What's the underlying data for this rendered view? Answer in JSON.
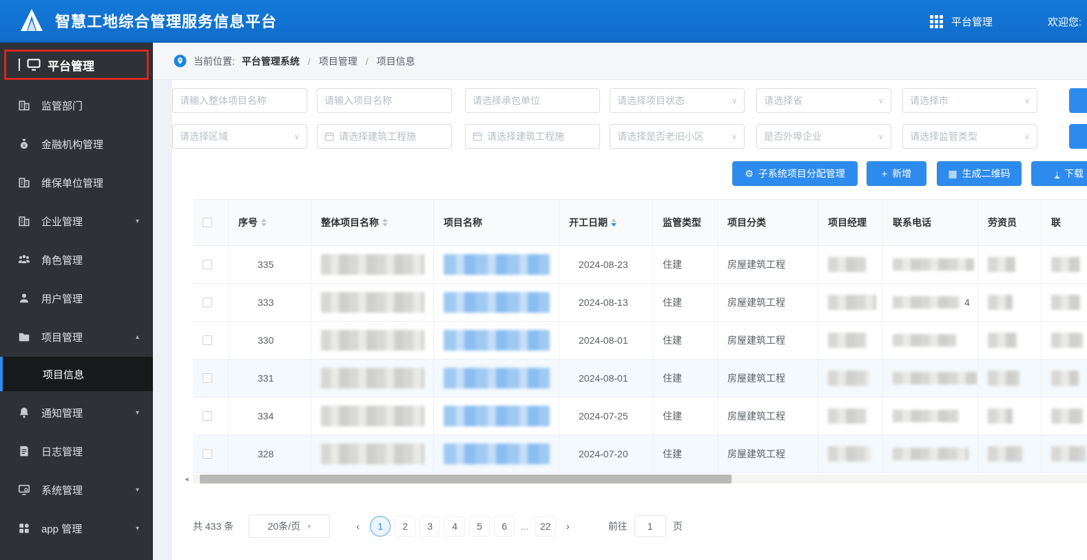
{
  "header": {
    "title": "智慧工地综合管理服务信息平台",
    "apps_label": "平台管理",
    "welcome": "欢迎您:"
  },
  "sidebar": {
    "root_label": "平台管理",
    "items": [
      {
        "label": "监管部门",
        "icon": "building-icon",
        "arrow": ""
      },
      {
        "label": "金融机构管理",
        "icon": "moneybag-icon",
        "arrow": ""
      },
      {
        "label": "维保单位管理",
        "icon": "building-icon",
        "arrow": ""
      },
      {
        "label": "企业管理",
        "icon": "building-icon",
        "arrow": "down"
      },
      {
        "label": "角色管理",
        "icon": "roles-icon",
        "arrow": ""
      },
      {
        "label": "用户管理",
        "icon": "user-icon",
        "arrow": ""
      },
      {
        "label": "项目管理",
        "icon": "folder-icon",
        "arrow": "up",
        "children": [
          {
            "label": "项目信息",
            "active": true
          }
        ]
      },
      {
        "label": "通知管理",
        "icon": "bell-icon",
        "arrow": "down"
      },
      {
        "label": "日志管理",
        "icon": "log-icon",
        "arrow": ""
      },
      {
        "label": "系统管理",
        "icon": "monitor-icon",
        "arrow": "down"
      },
      {
        "label": "app 管理",
        "icon": "grid-icon",
        "arrow": "down"
      }
    ]
  },
  "breadcrumb": {
    "prefix": "当前位置:",
    "root": "平台管理系统",
    "items": [
      "项目管理",
      "项目信息"
    ]
  },
  "filters": {
    "row1": [
      {
        "type": "input",
        "placeholder": "请输入整体项目名称"
      },
      {
        "type": "input",
        "placeholder": "请输入项目名称"
      },
      {
        "type": "input",
        "placeholder": "请选择承包单位"
      },
      {
        "type": "select",
        "placeholder": "请选择项目状态"
      },
      {
        "type": "select",
        "placeholder": "请选择省"
      },
      {
        "type": "select",
        "placeholder": "请选择市"
      }
    ],
    "row2": [
      {
        "type": "select",
        "placeholder": "请选择区域"
      },
      {
        "type": "date",
        "placeholder": "请选择建筑工程施"
      },
      {
        "type": "date",
        "placeholder": "请选择建筑工程施"
      },
      {
        "type": "select",
        "placeholder": "请选择是否老旧小区"
      },
      {
        "type": "select",
        "placeholder": "是否外埠企业"
      },
      {
        "type": "select",
        "placeholder": "请选择监管类型"
      }
    ]
  },
  "actions": [
    {
      "label": "子系统项目分配管理",
      "icon": "gear-icon"
    },
    {
      "label": "新增",
      "icon": "plus-icon"
    },
    {
      "label": "生成二维码",
      "icon": "qrcode-icon"
    },
    {
      "label": "下载",
      "icon": "download-icon"
    }
  ],
  "table": {
    "columns": [
      {
        "label": "",
        "type": "checkbox"
      },
      {
        "label": "序号",
        "sort": "both"
      },
      {
        "label": "整体项目名称",
        "sort": "both"
      },
      {
        "label": "项目名称"
      },
      {
        "label": "开工日期",
        "sort": "desc"
      },
      {
        "label": "监管类型"
      },
      {
        "label": "项目分类"
      },
      {
        "label": "项目经理"
      },
      {
        "label": "联系电话"
      },
      {
        "label": "劳资员"
      },
      {
        "label": "联"
      }
    ],
    "rows": [
      {
        "seq": "335",
        "date": "2024-08-23",
        "type": "住建",
        "category": "房屋建筑工程",
        "phone_suffix": ""
      },
      {
        "seq": "333",
        "date": "2024-08-13",
        "type": "住建",
        "category": "房屋建筑工程",
        "phone_suffix": "4"
      },
      {
        "seq": "330",
        "date": "2024-08-01",
        "type": "住建",
        "category": "房屋建筑工程",
        "phone_suffix": ""
      },
      {
        "seq": "331",
        "date": "2024-08-01",
        "type": "住建",
        "category": "房屋建筑工程",
        "phone_suffix": ""
      },
      {
        "seq": "334",
        "date": "2024-07-25",
        "type": "住建",
        "category": "房屋建筑工程",
        "phone_suffix": ""
      },
      {
        "seq": "328",
        "date": "2024-07-20",
        "type": "住建",
        "category": "房屋建筑工程",
        "phone_suffix": ""
      }
    ]
  },
  "pagination": {
    "total": "共 433 条",
    "page_size": "20条/页",
    "pages": [
      "1",
      "2",
      "3",
      "4",
      "5",
      "6",
      "...",
      "22"
    ],
    "current": "1",
    "goto_label": "前往",
    "goto_value": "1",
    "goto_suffix": "页"
  },
  "colors": {
    "header_blue": "#1272d3",
    "button_blue": "#2e8bee",
    "sidebar_dark": "#2e3237",
    "highlight_red": "#d5281e",
    "link_blue": "#8abdf0"
  }
}
